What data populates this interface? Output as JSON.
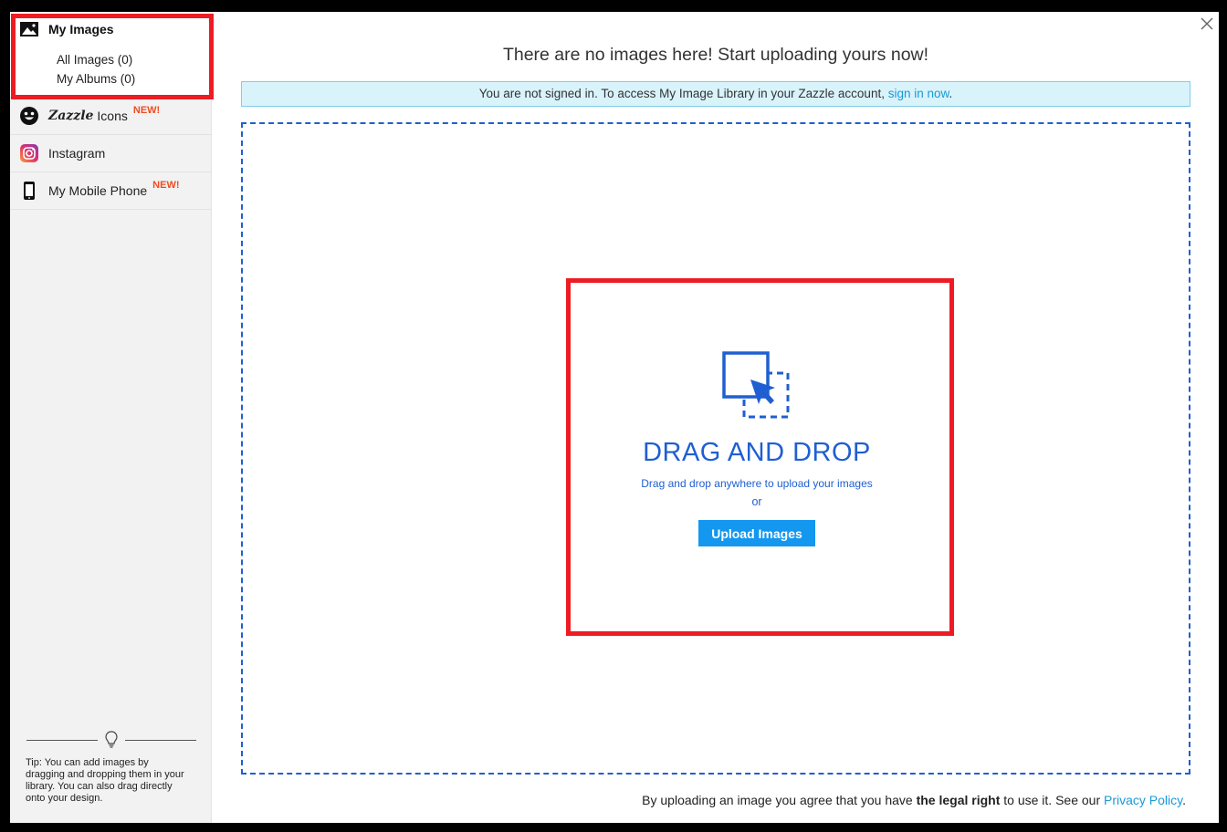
{
  "sidebar": {
    "my_images": {
      "title": "My Images",
      "all_images": "All Images (0)",
      "my_albums": "My Albums (0)"
    },
    "items": [
      {
        "label_brand": "Zazzle",
        "label": "Icons",
        "badge": "NEW!",
        "icon": "smiley-icon"
      },
      {
        "label": "Instagram",
        "icon": "instagram-icon"
      },
      {
        "label": "My Mobile Phone",
        "badge": "NEW!",
        "icon": "mobile-phone-icon"
      }
    ],
    "tip": "Tip: You can add images by dragging and dropping them in your library. You can also drag directly onto your design."
  },
  "main": {
    "headline": "There are no images here! Start uploading yours now!",
    "signin_notice": {
      "text": "You are not signed in. To access My Image Library in your Zazzle account,",
      "link": "sign in now",
      "suffix": "."
    },
    "dropzone": {
      "title": "DRAG AND DROP",
      "subtitle": "Drag and drop anywhere to upload your images",
      "or": "or",
      "upload_button": "Upload Images"
    },
    "legal": {
      "prefix": "By uploading an image you agree that you have",
      "bold": "the legal right",
      "middle": "to use it. See our",
      "link": "Privacy Policy",
      "suffix": "."
    }
  },
  "colors": {
    "accent_blue": "#1f5fd1",
    "button_blue": "#1397ef",
    "link_blue": "#1a9ad6",
    "new_badge": "#f04b23",
    "highlight_red": "#ed1c24",
    "notice_bg": "#d9f3fb"
  }
}
